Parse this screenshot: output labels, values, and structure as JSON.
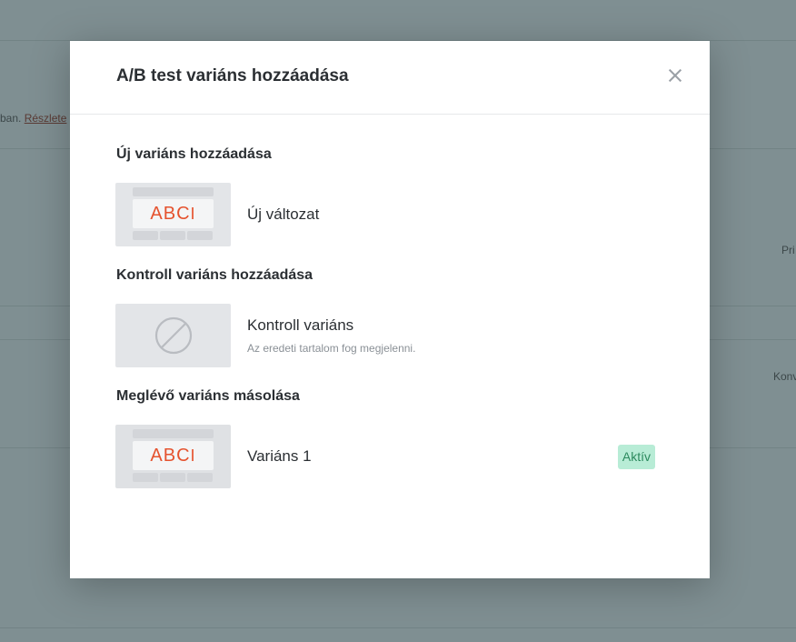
{
  "background": {
    "text_left_partial": "ban.",
    "link_partial": "Részlete",
    "text_right_1": "Pri",
    "text_right_2": "Konv"
  },
  "modal": {
    "title": "A/B test variáns hozzáadása",
    "close_icon": "close-icon"
  },
  "sections": {
    "new_title": "Új variáns hozzáadása",
    "control_title": "Kontroll variáns hozzáadása",
    "copy_title": "Meglévő variáns másolása"
  },
  "options": {
    "new_variant": {
      "label": "Új változat",
      "thumb_text": "ABC",
      "cursor": "I"
    },
    "control_variant": {
      "label": "Kontroll variáns",
      "description": "Az eredeti tartalom fog megjelenni.",
      "icon": "ban-icon"
    },
    "copy_variant": {
      "label": "Variáns 1",
      "thumb_text": "ABC",
      "cursor": "I",
      "badge": "Aktív"
    }
  },
  "colors": {
    "accent": "#e5532f",
    "badge_bg": "#b8ecd6",
    "badge_text": "#2c8a5e",
    "overlay": "#7f8f92"
  }
}
